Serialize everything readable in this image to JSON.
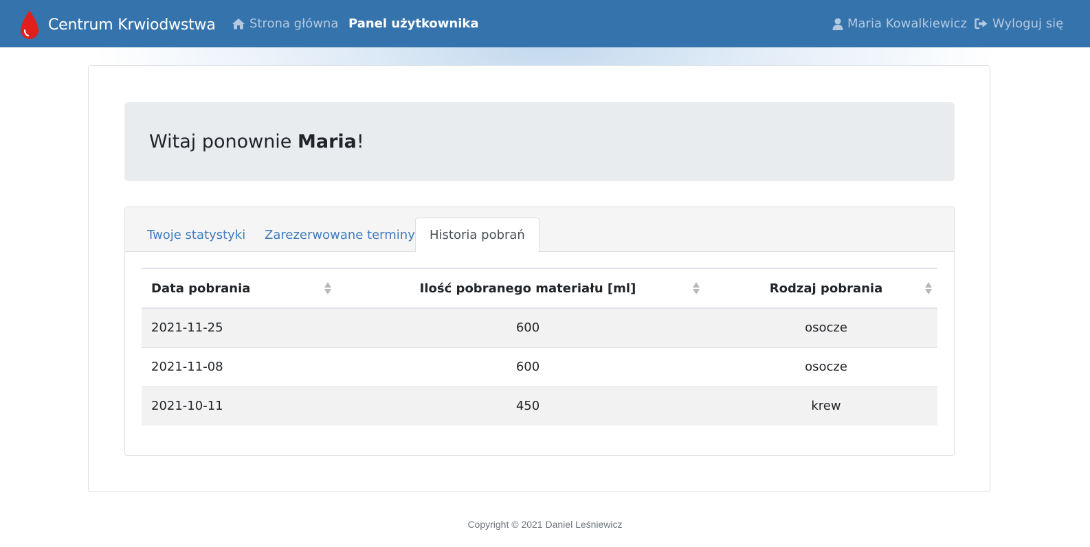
{
  "navbar": {
    "brand": "Centrum Krwiodwstwa",
    "links": [
      {
        "label": "Strona główna",
        "icon": "home-icon",
        "active": false
      },
      {
        "label": "Panel użytkownika",
        "active": true
      }
    ],
    "user": {
      "label": "Maria Kowalkiewicz",
      "icon": "user-icon"
    },
    "logout": {
      "label": "Wyloguj się",
      "icon": "sign-out-icon"
    },
    "colors": {
      "background": "#3573ac",
      "brand_drop": "#e0201c"
    }
  },
  "welcome": {
    "prefix": "Witaj ponownie ",
    "name": "Maria",
    "suffix": "!"
  },
  "tabs": [
    {
      "label": "Twoje statystyki",
      "active": false
    },
    {
      "label": "Zarezerwowane terminy",
      "active": false
    },
    {
      "label": "Historia pobrań",
      "active": true
    }
  ],
  "table": {
    "headers": [
      "Data pobrania",
      "Ilość pobranego materiału [ml]",
      "Rodzaj pobrania"
    ],
    "rows": [
      [
        "2021-11-25",
        "600",
        "osocze"
      ],
      [
        "2021-11-08",
        "600",
        "osocze"
      ],
      [
        "2021-10-11",
        "450",
        "krew"
      ]
    ]
  },
  "footer": {
    "text": "Copyright © 2021 Daniel Leśniewicz"
  }
}
